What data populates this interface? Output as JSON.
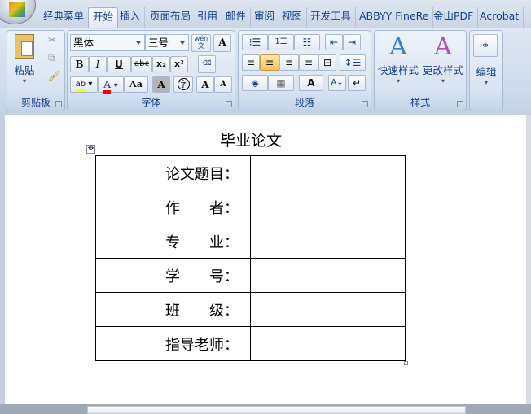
{
  "tabs": [
    "经典菜单",
    "开始",
    "插入",
    "页面布局",
    "引用",
    "邮件",
    "审阅",
    "视图",
    "开发工具",
    "ABBYY FineRe",
    "金山PDF",
    "Acrobat"
  ],
  "active_tab": "开始",
  "clipboard": {
    "label": "剪贴板",
    "paste": "粘贴"
  },
  "font": {
    "label": "字体",
    "font_name": "黑体",
    "font_size": "三号",
    "phonetic": "wén\n文",
    "border_char": "A",
    "bold": "B",
    "italic": "I",
    "underline": "U",
    "strike": "abc",
    "sub": "x₂",
    "sup": "x²",
    "highlight": "ab",
    "font_color": "A",
    "change_case": "Aa",
    "shade": "A",
    "enclose": "字",
    "grow": "A",
    "shrink": "A",
    "colors": {
      "highlight": "#ffff00",
      "font_color": "#ff0000"
    }
  },
  "paragraph": {
    "label": "段落",
    "bullets": "⁝☰",
    "numbering": "1☰",
    "multilevel": "☷",
    "dec_indent": "⇤",
    "inc_indent": "⇥",
    "align": [
      "≡",
      "≡",
      "≡",
      "≡",
      "⊟"
    ],
    "line_spacing": "↕☰",
    "shading": "◈",
    "borders": "▦",
    "asian": "A",
    "sort": "A↓",
    "marks": "↵"
  },
  "styles": {
    "label": "样式",
    "quick": "快速样式",
    "change": "更改样式"
  },
  "editing": {
    "label": "编辑"
  },
  "document": {
    "title": "毕业论文",
    "rows": [
      {
        "label": "论文题目：",
        "value": ""
      },
      {
        "label": "作　　者：",
        "value": ""
      },
      {
        "label": "专　　业：",
        "value": ""
      },
      {
        "label": "学　　号：",
        "value": ""
      },
      {
        "label": "班　　级：",
        "value": ""
      },
      {
        "label": "指导老师：",
        "value": ""
      }
    ]
  }
}
